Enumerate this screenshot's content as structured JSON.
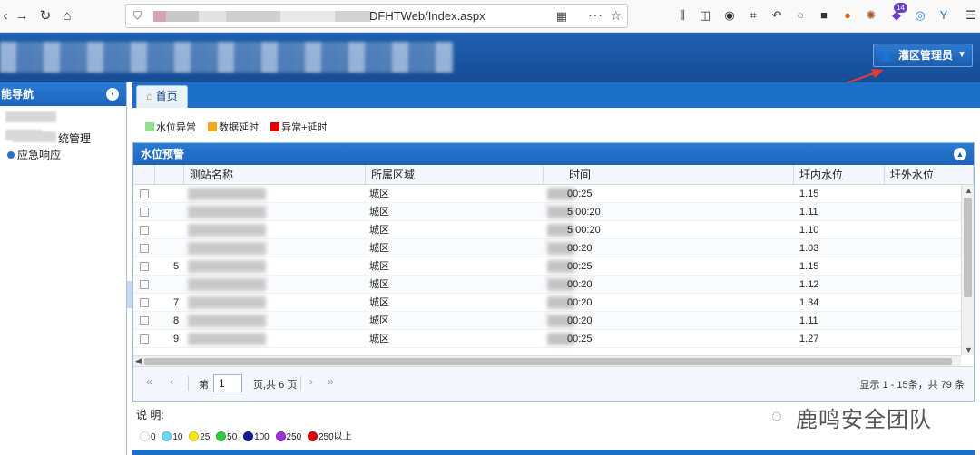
{
  "browser": {
    "url_visible": "DFHTWeb/Index.aspx"
  },
  "header": {
    "admin_label": "灌区管理员",
    "colors": {
      "bar": "#1c5aa8",
      "accent": "#1e6fc9",
      "arrow": "#e53935"
    }
  },
  "sidebar": {
    "title": "能导航",
    "items": [
      {
        "label": "统管理"
      },
      {
        "label": "应急响应"
      }
    ]
  },
  "tabs": [
    {
      "label": "首页"
    }
  ],
  "legend": [
    {
      "label": "水位异常",
      "color": "#8fe08f"
    },
    {
      "label": "数据延时",
      "color": "#f5a623"
    },
    {
      "label": "异常+延时",
      "color": "#e00000"
    }
  ],
  "panel": {
    "title": "水位预警",
    "columns": [
      "测站名称",
      "所属区域",
      "时间",
      "圩内水位",
      "圩外水位"
    ],
    "rows": [
      {
        "no": "",
        "area": "城区",
        "time": "00:25",
        "inner": "1.15"
      },
      {
        "no": "",
        "area": "城区",
        "time": "5 00:20",
        "inner": "1.11"
      },
      {
        "no": "",
        "area": "城区",
        "time": "5 00:20",
        "inner": "1.10"
      },
      {
        "no": "",
        "area": "城区",
        "time": "00:20",
        "inner": "1.03"
      },
      {
        "no": "5",
        "area": "城区",
        "time": "00:25",
        "inner": "1.15"
      },
      {
        "no": "",
        "area": "城区",
        "time": "00:20",
        "inner": "1.12"
      },
      {
        "no": "7",
        "area": "城区",
        "time": "00:20",
        "inner": "1.34"
      },
      {
        "no": "8",
        "area": "城区",
        "time": "00:20",
        "inner": "1.11"
      },
      {
        "no": "9",
        "area": "城区",
        "time": "00:25",
        "inner": "1.27"
      }
    ]
  },
  "pager": {
    "page_label": "第",
    "page_value": "1",
    "page_total": "页,共 6 页",
    "info": "显示 1 - 15条，共 79 条"
  },
  "note": {
    "title": "说 明:",
    "scale": [
      {
        "label": "0",
        "color": "#ffffff"
      },
      {
        "label": "10",
        "color": "#6fd3f0"
      },
      {
        "label": "25",
        "color": "#f6e51b"
      },
      {
        "label": "50",
        "color": "#2ecc40"
      },
      {
        "label": "100",
        "color": "#0b1e8c"
      },
      {
        "label": "250",
        "color": "#9b30d9"
      },
      {
        "label": "250以上",
        "color": "#e00000"
      }
    ]
  },
  "watermark": "鹿鸣安全团队"
}
